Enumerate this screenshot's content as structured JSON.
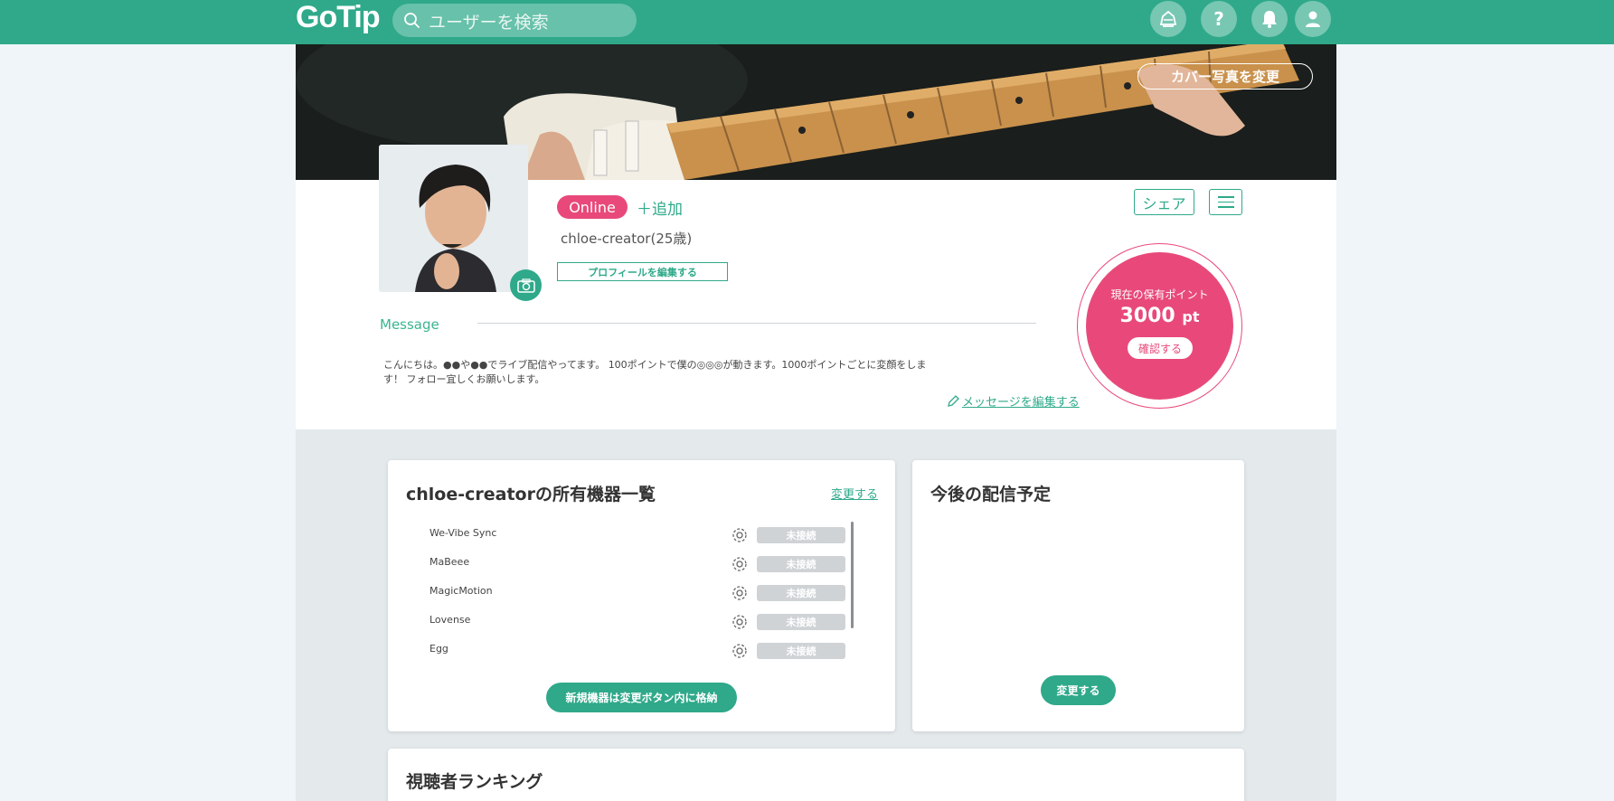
{
  "header": {
    "logo": "GoTip",
    "search_placeholder": "ユーザーを検索",
    "icons": [
      "ranking-icon",
      "help-icon",
      "bell-icon",
      "user-icon"
    ],
    "help_glyph": "?"
  },
  "cover": {
    "change_label": "カバー写真を変更"
  },
  "profile": {
    "status": "Online",
    "add_label": "＋追加",
    "username": "chloe-creator(25歳)",
    "edit_profile_label": "プロフィールを編集する",
    "share_label": "シェア",
    "message_label": "Message",
    "message_text": "こんにちは。●●や●●でライブ配信やってます。 100ポイントで僕の◎◎◎が動きます。1000ポイントごとに変顔をします！ フォロー宜しくお願いします。",
    "edit_message_label": "メッセージを編集する"
  },
  "points": {
    "label": "現在の保有ポイント",
    "value": "3000",
    "unit": "pt",
    "check_label": "確認する"
  },
  "devices": {
    "title": "chloe-creatorの所有機器一覧",
    "change_link": "変更する",
    "items": [
      {
        "name": "We-Vibe Sync",
        "status": "未接続"
      },
      {
        "name": "MaBeee",
        "status": "未接続"
      },
      {
        "name": "MagicMotion",
        "status": "未接続"
      },
      {
        "name": "Lovense",
        "status": "未接続"
      },
      {
        "name": "Egg",
        "status": "未接続"
      }
    ],
    "new_device_label": "新規機器は変更ボタン内に格納"
  },
  "schedule": {
    "title": "今後の配信予定",
    "change_label": "変更する"
  },
  "ranking": {
    "title": "視聴者ランキング"
  },
  "colors": {
    "brand": "#2fa98a",
    "accent": "#e8497a",
    "status_bg": "#cfd3d6"
  }
}
